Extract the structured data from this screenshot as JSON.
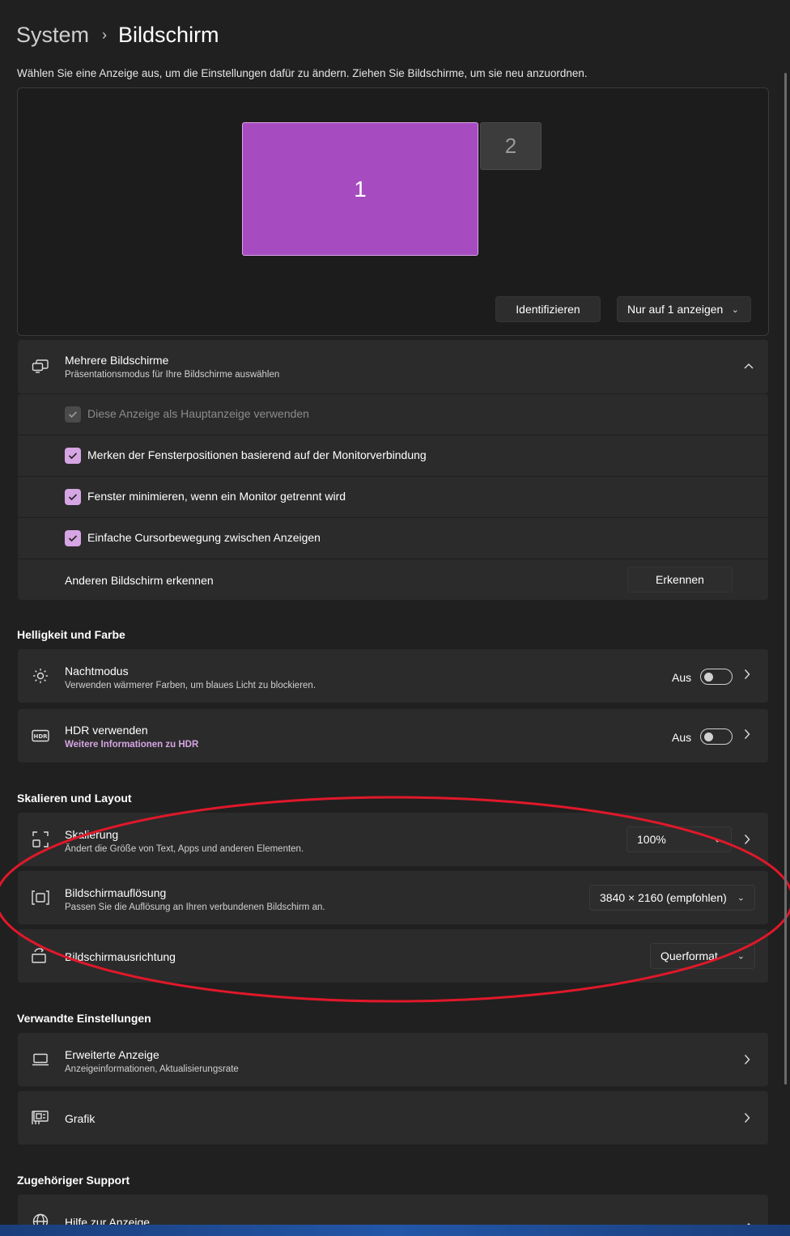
{
  "breadcrumb": {
    "parent": "System",
    "separator": "›",
    "current": "Bildschirm"
  },
  "intro_text": "Wählen Sie eine Anzeige aus, um die Einstellungen dafür zu ändern. Ziehen Sie Bildschirme, um sie neu anzuordnen.",
  "monitors": [
    {
      "label": "1",
      "selected": true
    },
    {
      "label": "2",
      "selected": false
    }
  ],
  "arrange_buttons": {
    "identify": "Identifizieren",
    "mode": "Nur auf 1 anzeigen"
  },
  "multiple_displays": {
    "title": "Mehrere Bildschirme",
    "subtitle": "Präsentationsmodus für Ihre Bildschirme auswählen",
    "options": [
      {
        "label": "Diese Anzeige als Hauptanzeige verwenden",
        "checked": true,
        "disabled": true
      },
      {
        "label": "Merken der Fensterpositionen basierend auf der Monitorverbindung",
        "checked": true,
        "disabled": false
      },
      {
        "label": "Fenster minimieren, wenn ein Monitor getrennt wird",
        "checked": true,
        "disabled": false
      },
      {
        "label": "Einfache Cursorbewegung zwischen Anzeigen",
        "checked": true,
        "disabled": false
      }
    ],
    "detect_label": "Anderen Bildschirm erkennen",
    "detect_button": "Erkennen"
  },
  "brightness_section": {
    "heading": "Helligkeit und Farbe",
    "night_mode": {
      "title": "Nachtmodus",
      "subtitle": "Verwenden wärmerer Farben, um blaues Licht zu blockieren.",
      "state": "Aus"
    },
    "hdr": {
      "title": "HDR verwenden",
      "link": "Weitere Informationen zu HDR",
      "state": "Aus"
    }
  },
  "scale_section": {
    "heading": "Skalieren und Layout",
    "scaling": {
      "title": "Skalierung",
      "subtitle": "Ändert die Größe von Text, Apps und anderen Elementen.",
      "value": "100%"
    },
    "resolution": {
      "title": "Bildschirmauflösung",
      "subtitle": "Passen Sie die Auflösung an Ihren verbundenen Bildschirm an.",
      "value": "3840 × 2160 (empfohlen)"
    },
    "orientation": {
      "title": "Bildschirmausrichtung",
      "value": "Querformat"
    }
  },
  "related_section": {
    "heading": "Verwandte Einstellungen",
    "advanced": {
      "title": "Erweiterte Anzeige",
      "subtitle": "Anzeigeinformationen, Aktualisierungsrate"
    },
    "graphics": {
      "title": "Grafik"
    }
  },
  "support_section": {
    "heading": "Zugehöriger Support",
    "help": {
      "title": "Hilfe zur Anzeige"
    }
  },
  "colors": {
    "accent": "#d6a5e4",
    "monitor_selected": "#a64cc0",
    "annotation": "#e0182a",
    "background": "#202020",
    "card": "#2b2b2b"
  },
  "annotation": {
    "shape": "red-ellipse",
    "encircles": "Skalieren und Layout"
  }
}
